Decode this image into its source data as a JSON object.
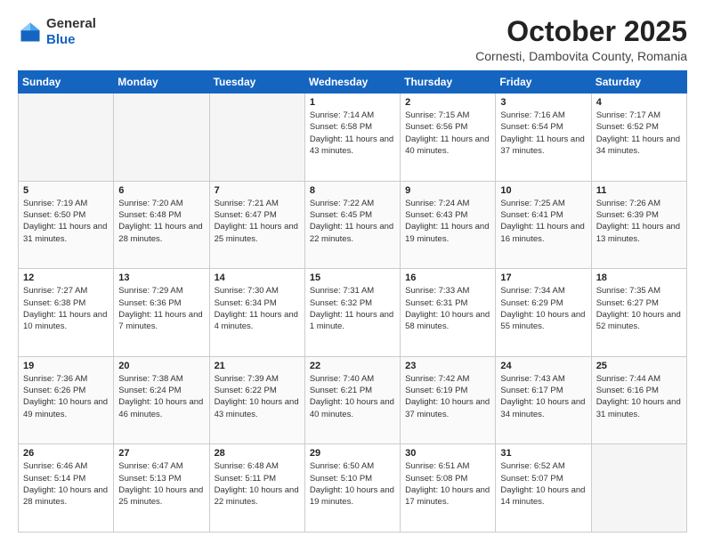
{
  "header": {
    "logo_line1": "General",
    "logo_line2": "Blue",
    "month": "October 2025",
    "location": "Cornesti, Dambovita County, Romania"
  },
  "weekdays": [
    "Sunday",
    "Monday",
    "Tuesday",
    "Wednesday",
    "Thursday",
    "Friday",
    "Saturday"
  ],
  "weeks": [
    [
      {
        "day": "",
        "info": ""
      },
      {
        "day": "",
        "info": ""
      },
      {
        "day": "",
        "info": ""
      },
      {
        "day": "1",
        "info": "Sunrise: 7:14 AM\nSunset: 6:58 PM\nDaylight: 11 hours and 43 minutes."
      },
      {
        "day": "2",
        "info": "Sunrise: 7:15 AM\nSunset: 6:56 PM\nDaylight: 11 hours and 40 minutes."
      },
      {
        "day": "3",
        "info": "Sunrise: 7:16 AM\nSunset: 6:54 PM\nDaylight: 11 hours and 37 minutes."
      },
      {
        "day": "4",
        "info": "Sunrise: 7:17 AM\nSunset: 6:52 PM\nDaylight: 11 hours and 34 minutes."
      }
    ],
    [
      {
        "day": "5",
        "info": "Sunrise: 7:19 AM\nSunset: 6:50 PM\nDaylight: 11 hours and 31 minutes."
      },
      {
        "day": "6",
        "info": "Sunrise: 7:20 AM\nSunset: 6:48 PM\nDaylight: 11 hours and 28 minutes."
      },
      {
        "day": "7",
        "info": "Sunrise: 7:21 AM\nSunset: 6:47 PM\nDaylight: 11 hours and 25 minutes."
      },
      {
        "day": "8",
        "info": "Sunrise: 7:22 AM\nSunset: 6:45 PM\nDaylight: 11 hours and 22 minutes."
      },
      {
        "day": "9",
        "info": "Sunrise: 7:24 AM\nSunset: 6:43 PM\nDaylight: 11 hours and 19 minutes."
      },
      {
        "day": "10",
        "info": "Sunrise: 7:25 AM\nSunset: 6:41 PM\nDaylight: 11 hours and 16 minutes."
      },
      {
        "day": "11",
        "info": "Sunrise: 7:26 AM\nSunset: 6:39 PM\nDaylight: 11 hours and 13 minutes."
      }
    ],
    [
      {
        "day": "12",
        "info": "Sunrise: 7:27 AM\nSunset: 6:38 PM\nDaylight: 11 hours and 10 minutes."
      },
      {
        "day": "13",
        "info": "Sunrise: 7:29 AM\nSunset: 6:36 PM\nDaylight: 11 hours and 7 minutes."
      },
      {
        "day": "14",
        "info": "Sunrise: 7:30 AM\nSunset: 6:34 PM\nDaylight: 11 hours and 4 minutes."
      },
      {
        "day": "15",
        "info": "Sunrise: 7:31 AM\nSunset: 6:32 PM\nDaylight: 11 hours and 1 minute."
      },
      {
        "day": "16",
        "info": "Sunrise: 7:33 AM\nSunset: 6:31 PM\nDaylight: 10 hours and 58 minutes."
      },
      {
        "day": "17",
        "info": "Sunrise: 7:34 AM\nSunset: 6:29 PM\nDaylight: 10 hours and 55 minutes."
      },
      {
        "day": "18",
        "info": "Sunrise: 7:35 AM\nSunset: 6:27 PM\nDaylight: 10 hours and 52 minutes."
      }
    ],
    [
      {
        "day": "19",
        "info": "Sunrise: 7:36 AM\nSunset: 6:26 PM\nDaylight: 10 hours and 49 minutes."
      },
      {
        "day": "20",
        "info": "Sunrise: 7:38 AM\nSunset: 6:24 PM\nDaylight: 10 hours and 46 minutes."
      },
      {
        "day": "21",
        "info": "Sunrise: 7:39 AM\nSunset: 6:22 PM\nDaylight: 10 hours and 43 minutes."
      },
      {
        "day": "22",
        "info": "Sunrise: 7:40 AM\nSunset: 6:21 PM\nDaylight: 10 hours and 40 minutes."
      },
      {
        "day": "23",
        "info": "Sunrise: 7:42 AM\nSunset: 6:19 PM\nDaylight: 10 hours and 37 minutes."
      },
      {
        "day": "24",
        "info": "Sunrise: 7:43 AM\nSunset: 6:17 PM\nDaylight: 10 hours and 34 minutes."
      },
      {
        "day": "25",
        "info": "Sunrise: 7:44 AM\nSunset: 6:16 PM\nDaylight: 10 hours and 31 minutes."
      }
    ],
    [
      {
        "day": "26",
        "info": "Sunrise: 6:46 AM\nSunset: 5:14 PM\nDaylight: 10 hours and 28 minutes."
      },
      {
        "day": "27",
        "info": "Sunrise: 6:47 AM\nSunset: 5:13 PM\nDaylight: 10 hours and 25 minutes."
      },
      {
        "day": "28",
        "info": "Sunrise: 6:48 AM\nSunset: 5:11 PM\nDaylight: 10 hours and 22 minutes."
      },
      {
        "day": "29",
        "info": "Sunrise: 6:50 AM\nSunset: 5:10 PM\nDaylight: 10 hours and 19 minutes."
      },
      {
        "day": "30",
        "info": "Sunrise: 6:51 AM\nSunset: 5:08 PM\nDaylight: 10 hours and 17 minutes."
      },
      {
        "day": "31",
        "info": "Sunrise: 6:52 AM\nSunset: 5:07 PM\nDaylight: 10 hours and 14 minutes."
      },
      {
        "day": "",
        "info": ""
      }
    ]
  ]
}
